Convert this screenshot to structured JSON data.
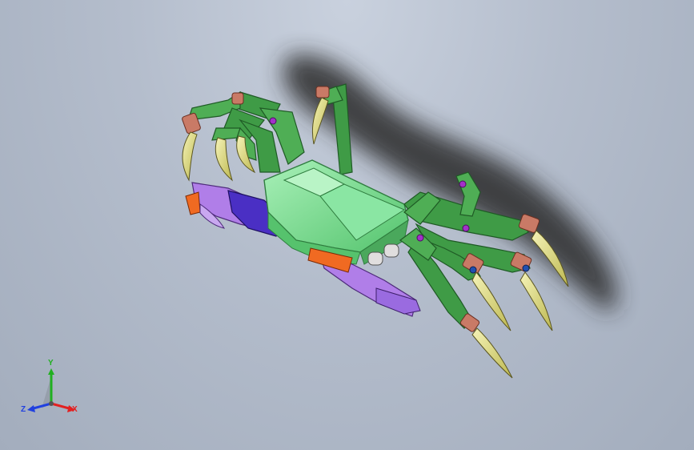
{
  "viewport": {
    "background_colors": [
      "#c9d1de",
      "#a3adbd"
    ]
  },
  "model": {
    "part_colors": {
      "body": "#7fe09a",
      "body_edge": "#2f7d3f",
      "leg": "#3f9b46",
      "leg_dark": "#2b6d32",
      "joint": "#c97a66",
      "claw": "#e8e58a",
      "joint_pin": "#a330c9",
      "arm_purple": "#b07ee8",
      "arm_blue": "#4a2fc4",
      "arm_orange": "#f06a22",
      "shadow": "#2a2a2a"
    }
  },
  "triad": {
    "x_label": "X",
    "y_label": "Y",
    "z_label": "Z",
    "x_color": "#e22020",
    "y_color": "#20b020",
    "z_color": "#2040e0"
  }
}
